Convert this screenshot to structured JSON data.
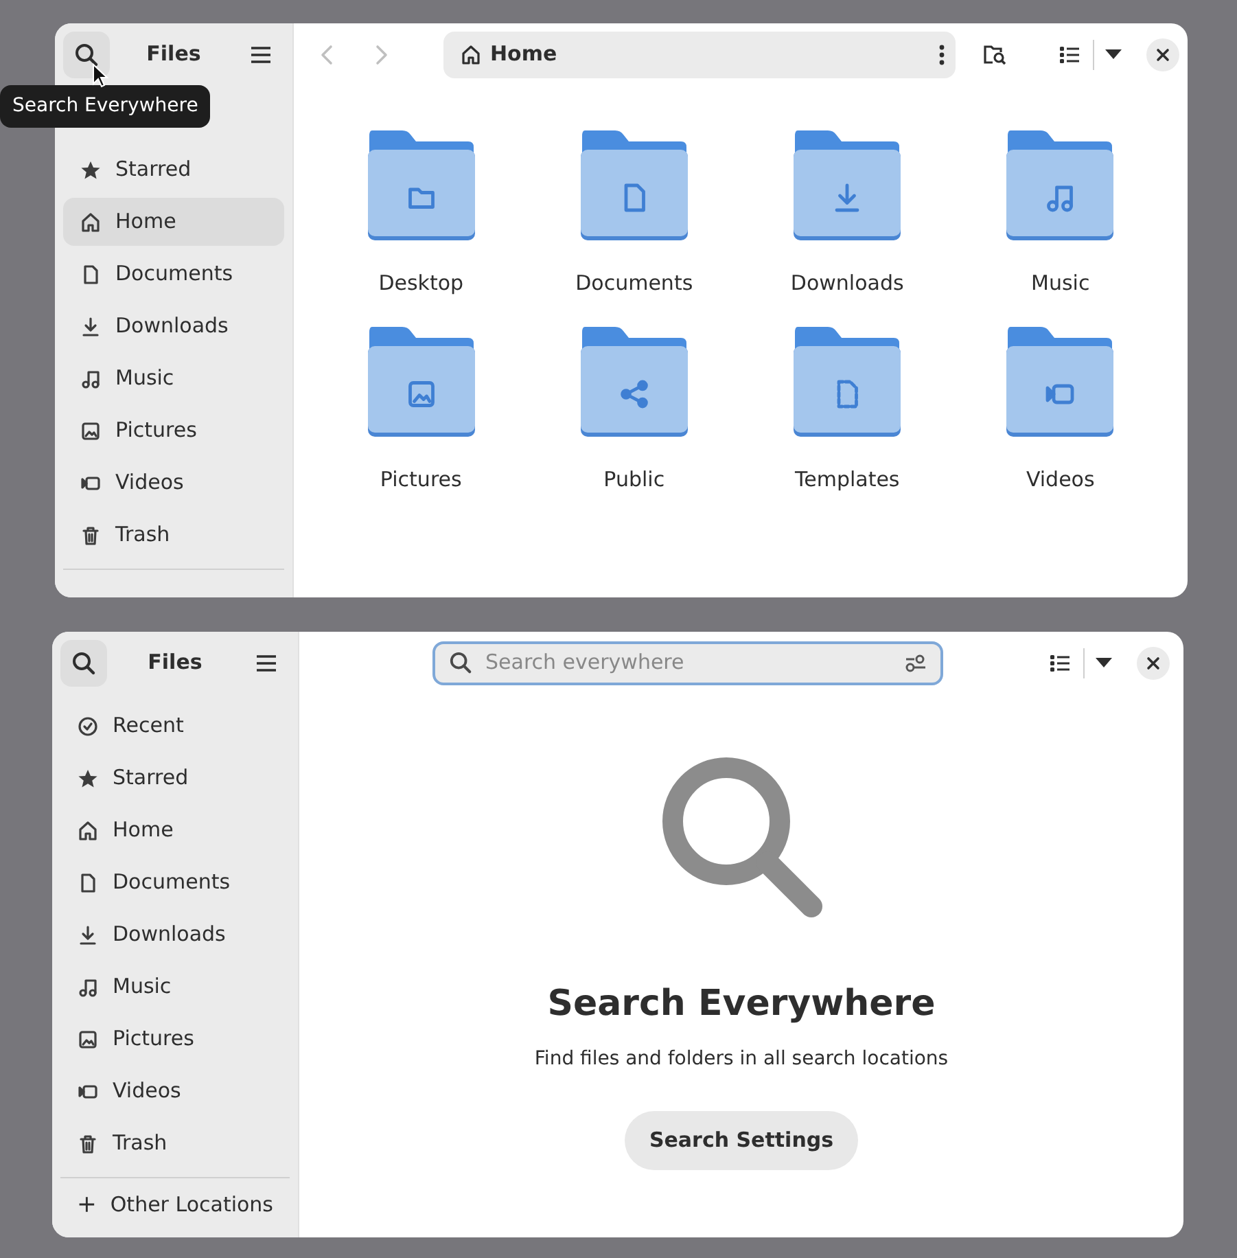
{
  "top_window": {
    "title": "Files",
    "tooltip": "Search Everywhere",
    "sidebar": [
      {
        "label": "Starred",
        "kind": "star",
        "selected": false
      },
      {
        "label": "Home",
        "kind": "home",
        "selected": true
      },
      {
        "label": "Documents",
        "kind": "document",
        "selected": false
      },
      {
        "label": "Downloads",
        "kind": "download",
        "selected": false
      },
      {
        "label": "Music",
        "kind": "music",
        "selected": false
      },
      {
        "label": "Pictures",
        "kind": "picture",
        "selected": false
      },
      {
        "label": "Videos",
        "kind": "video",
        "selected": false
      },
      {
        "label": "Trash",
        "kind": "trash",
        "selected": false
      }
    ],
    "nav": [
      {
        "kind": "back",
        "disabled": true
      },
      {
        "kind": "forward",
        "disabled": true
      }
    ],
    "path": "Home",
    "folders": [
      {
        "label": "Desktop",
        "kind": "folder"
      },
      {
        "label": "Documents",
        "kind": "document"
      },
      {
        "label": "Downloads",
        "kind": "download"
      },
      {
        "label": "Music",
        "kind": "music"
      },
      {
        "label": "Pictures",
        "kind": "picture"
      },
      {
        "label": "Public",
        "kind": "share"
      },
      {
        "label": "Templates",
        "kind": "template"
      },
      {
        "label": "Videos",
        "kind": "video"
      }
    ]
  },
  "bottom_window": {
    "title": "Files",
    "sidebar": [
      {
        "label": "Recent",
        "kind": "recent",
        "selected": false
      },
      {
        "label": "Starred",
        "kind": "star",
        "selected": false
      },
      {
        "label": "Home",
        "kind": "home",
        "selected": false
      },
      {
        "label": "Documents",
        "kind": "document",
        "selected": false
      },
      {
        "label": "Downloads",
        "kind": "download",
        "selected": false
      },
      {
        "label": "Music",
        "kind": "music",
        "selected": false
      },
      {
        "label": "Pictures",
        "kind": "picture",
        "selected": false
      },
      {
        "label": "Videos",
        "kind": "video",
        "selected": false
      },
      {
        "label": "Trash",
        "kind": "trash",
        "selected": false
      }
    ],
    "other_locations": "Other Locations",
    "search": {
      "placeholder": "Search everywhere"
    },
    "empty_title": "Search Everywhere",
    "empty_text": "Find files and folders in all search locations",
    "button": "Search Settings"
  }
}
